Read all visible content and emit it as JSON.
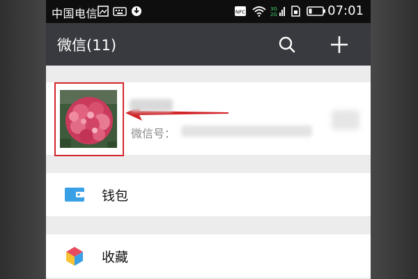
{
  "status_bar": {
    "carrier": "中国电信",
    "time": "07:01"
  },
  "header": {
    "title": "微信(11)",
    "icons": [
      "search-icon",
      "plus-icon"
    ]
  },
  "profile": {
    "wechat_id_label": "微信号："
  },
  "menu": {
    "items": [
      {
        "label": "钱包",
        "icon": "wallet-icon"
      },
      {
        "label": "收藏",
        "icon": "favorites-icon"
      }
    ]
  },
  "colors": {
    "header_bg": "#393a3f",
    "status_bar_bg": "#0e0e0e",
    "highlight_red": "#d2262b",
    "wallet_blue": "#3aa0e6",
    "page_bg": "#ececec"
  }
}
